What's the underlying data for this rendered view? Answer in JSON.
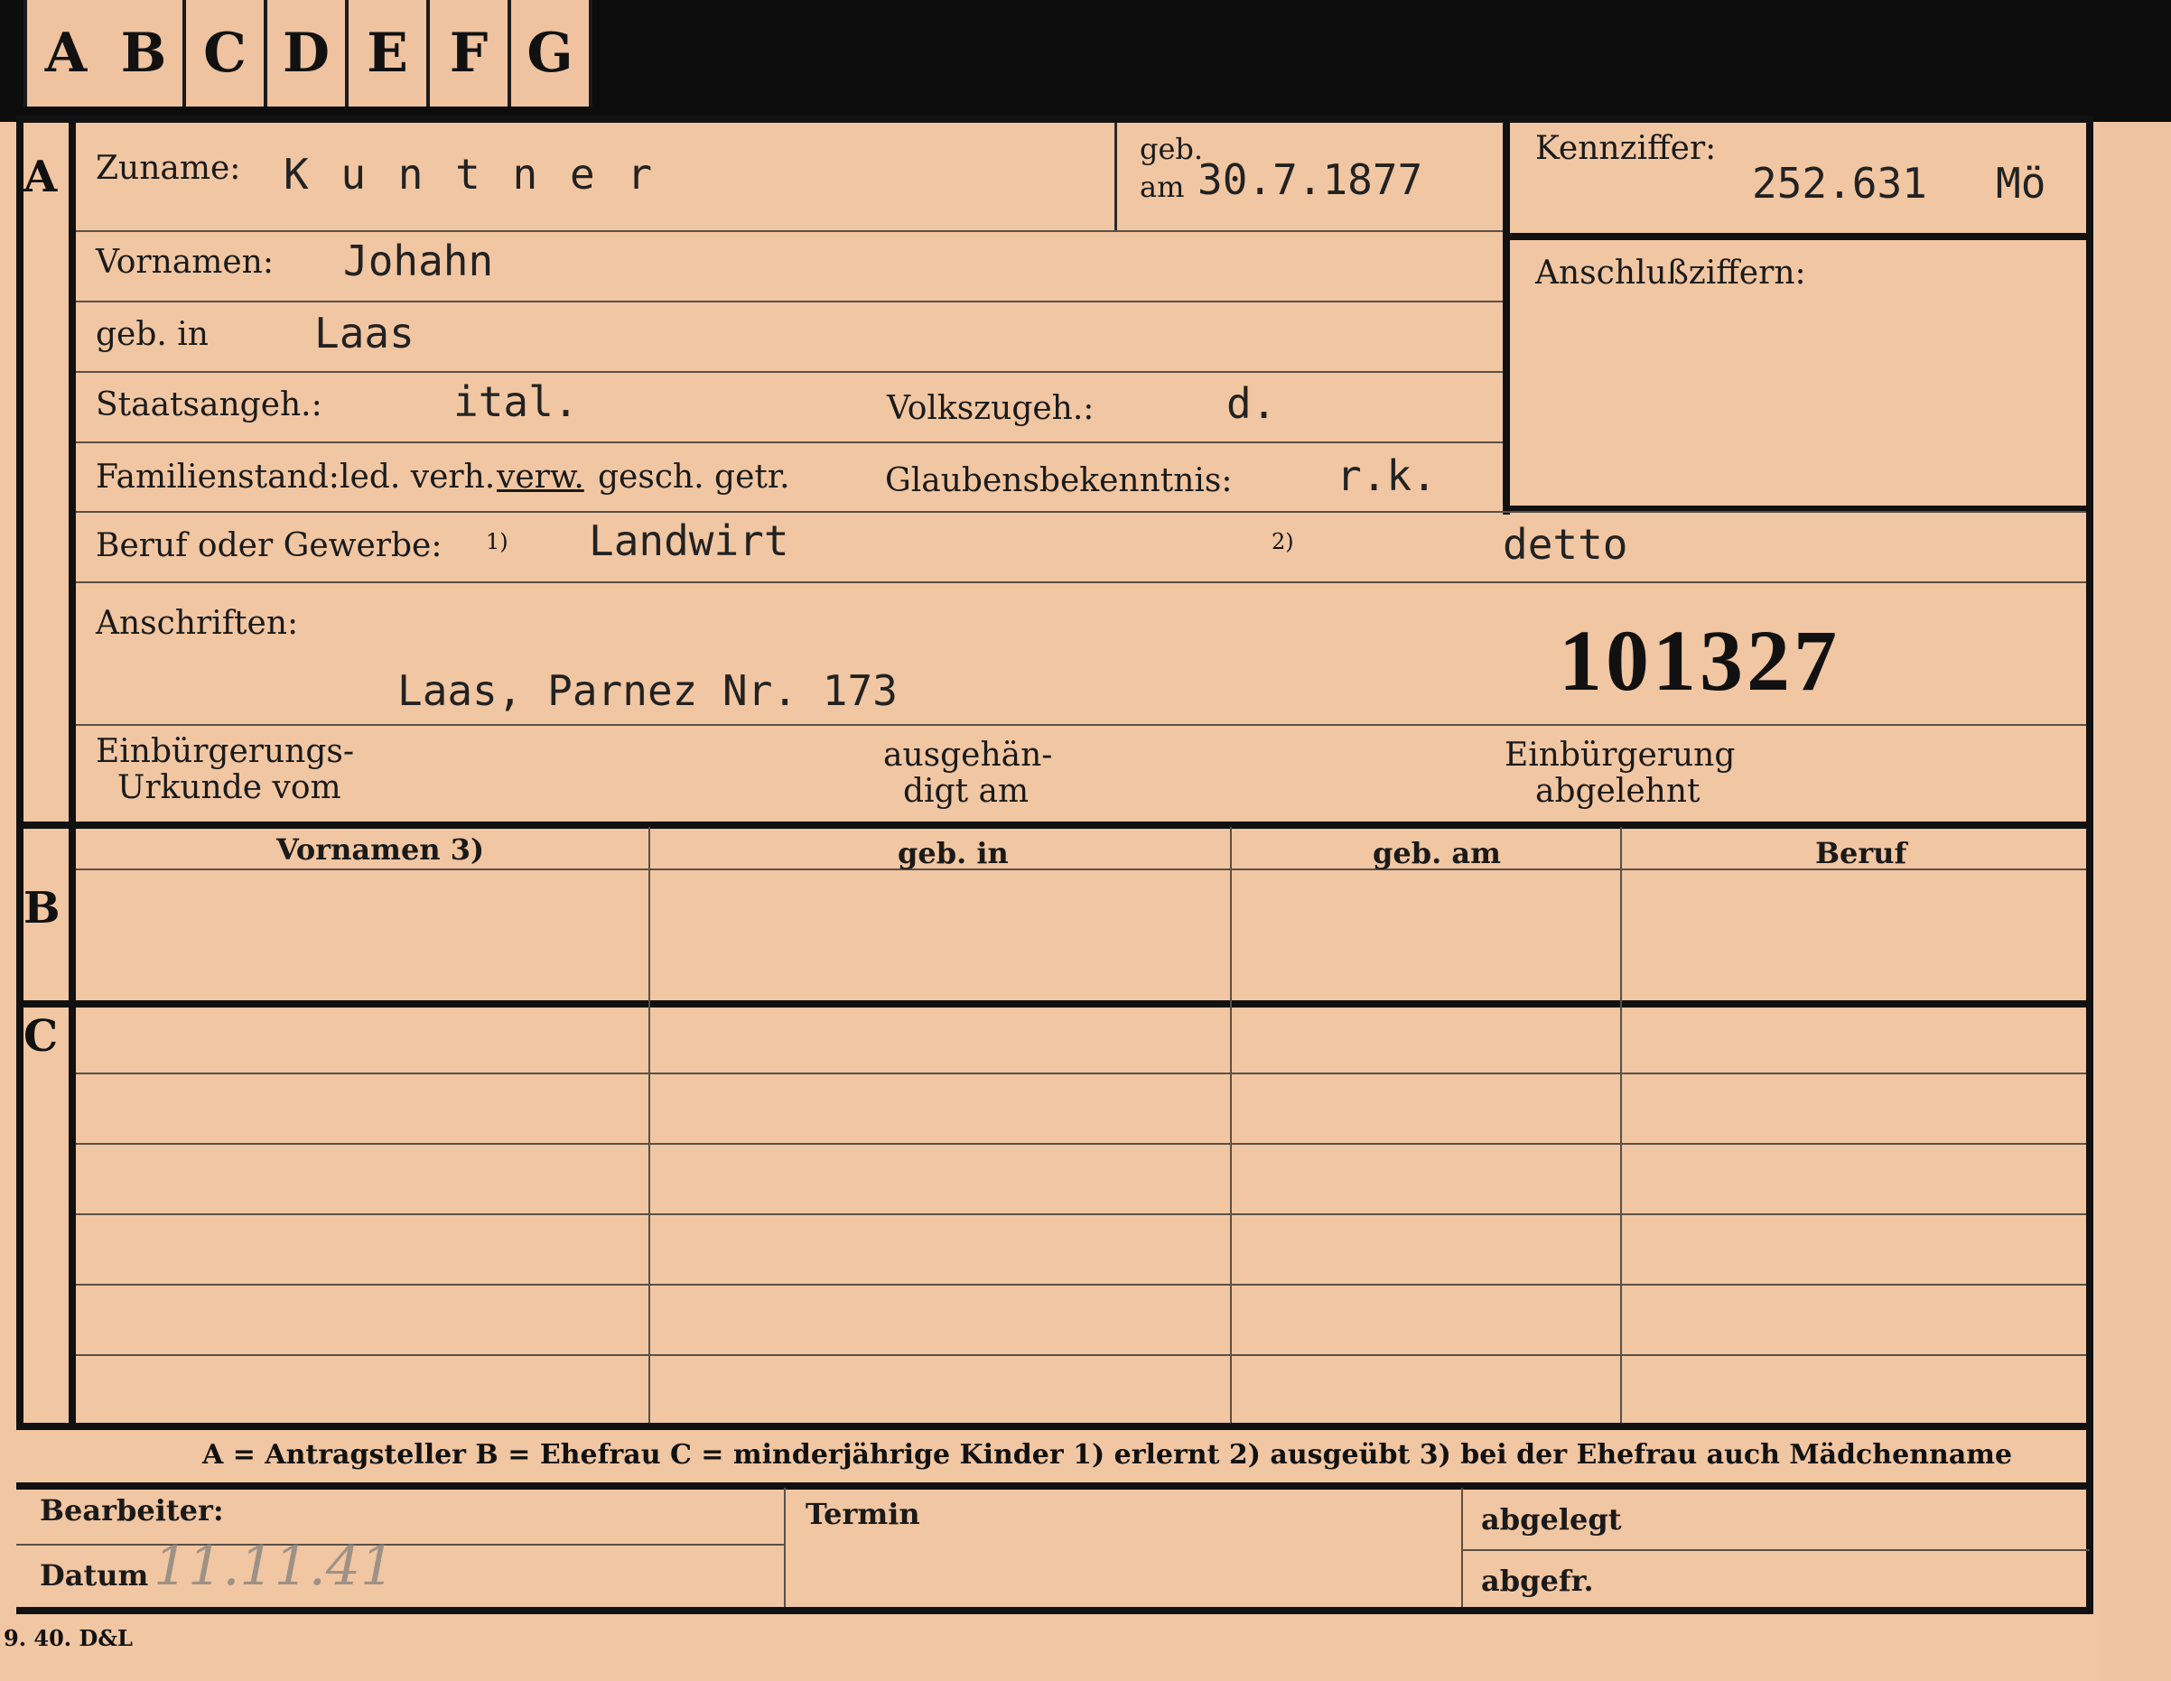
{
  "tabs": [
    "A",
    "B",
    "C",
    "D",
    "E",
    "F",
    "G"
  ],
  "sections": {
    "a": "A",
    "b": "B",
    "c": "C"
  },
  "fields": {
    "zuname_label": "Zuname:",
    "zuname_value": "K u n t n e r",
    "geb_label_1": "geb.",
    "geb_label_2": "am",
    "geb_am_value": "30.7.1877",
    "kennziffer_label": "Kennziffer:",
    "kennziffer_value": "252.631",
    "kennziffer_suffix": "Mö",
    "anschlussziffern_label": "Anschlußziffern:",
    "vornamen_label": "Vornamen:",
    "vornamen_value": "Johahn",
    "geb_in_label": "geb. in",
    "geb_in_value": "Laas",
    "staatsangeh_label": "Staatsangeh.:",
    "staatsangeh_value": "ital.",
    "volkszugeh_label": "Volkszugeh.:",
    "volkszugeh_value": "d.",
    "familienstand_label": "Familienstand:",
    "familienstand_opt1": "led. verh.",
    "familienstand_selected": "verw.",
    "familienstand_opt2": "gesch. getr.",
    "glaubens_label": "Glaubensbekenntnis:",
    "glaubens_value": "r.k.",
    "beruf_label": "Beruf oder Gewerbe:",
    "beruf_note1": "1)",
    "beruf_value1": "Landwirt",
    "beruf_note2": "2)",
    "beruf_value2": "detto",
    "anschriften_label": "Anschriften:",
    "anschriften_value": "Laas, Parnez Nr. 173",
    "file_number": "101327",
    "urkunde_label_1": "Einbürgerungs-",
    "urkunde_label_2": "Urkunde vom",
    "ausgehaendigt_label_1": "ausgehän-",
    "ausgehaendigt_label_2": "digt am",
    "abgelehnt_label_1": "Einbürgerung",
    "abgelehnt_label_2": "abgelehnt"
  },
  "table": {
    "headers": [
      "Vornamen 3)",
      "geb. in",
      "geb. am",
      "Beruf"
    ]
  },
  "legend": "A = Antragsteller   B = Ehefrau   C = minderjährige Kinder   1) erlernt   2) ausgeübt   3) bei der Ehefrau auch Mädchenname",
  "footer": {
    "bearbeiter_label": "Bearbeiter:",
    "datum_label": "Datum",
    "datum_value": "11.11.41",
    "termin_label": "Termin",
    "abgelegt_label": "abgelegt",
    "abgefr_label": "abgefr.",
    "print_code": "9. 40. D&L"
  }
}
